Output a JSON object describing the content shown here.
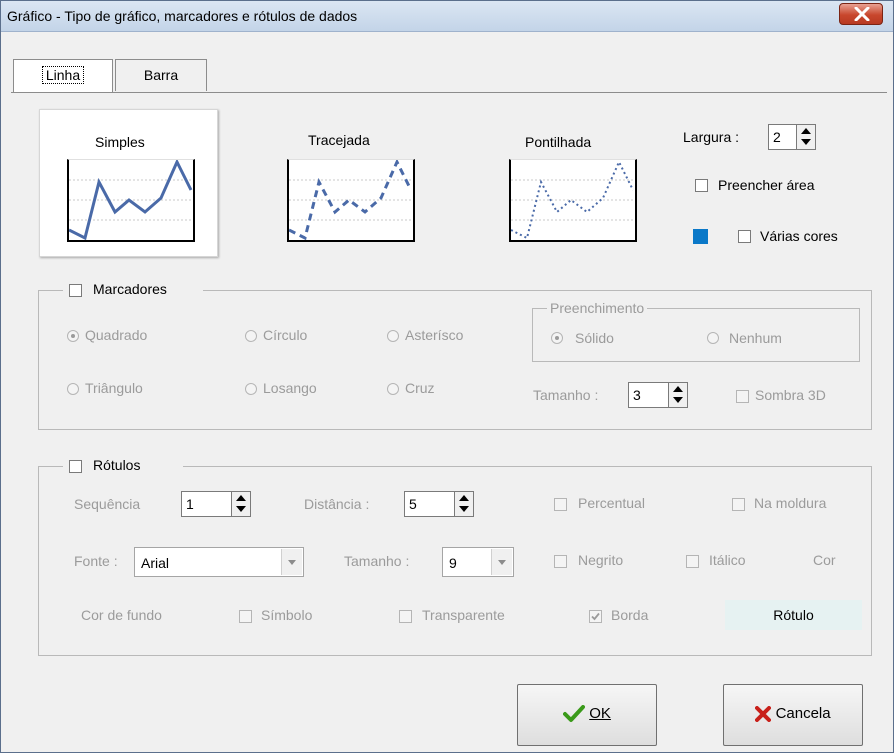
{
  "window": {
    "title": "Gráfico - Tipo de gráfico, marcadores e rótulos de dados",
    "close_icon": "x-icon"
  },
  "tabs": [
    {
      "label": "Linha",
      "active": true
    },
    {
      "label": "Barra",
      "active": false
    }
  ],
  "line_styles": [
    {
      "label": "Simples",
      "selected": true
    },
    {
      "label": "Tracejada",
      "selected": false
    },
    {
      "label": "Pontilhada",
      "selected": false
    }
  ],
  "line_options": {
    "width_label": "Largura :",
    "width_value": "2",
    "fill_area_label": "Preencher área",
    "multi_colors_label": "Várias cores",
    "swatch_color": "#0a78c8"
  },
  "markers": {
    "label": "Marcadores",
    "shapes": [
      "Quadrado",
      "Círculo",
      "Asterísco",
      "Triângulo",
      "Losango",
      "Cruz"
    ],
    "fill_group_label": "Preenchimento",
    "fill_options": [
      "Sólido",
      "Nenhum"
    ],
    "size_label": "Tamanho :",
    "size_value": "3",
    "shadow_label": "Sombra 3D"
  },
  "labels": {
    "label": "Rótulos",
    "sequence_label": "Sequência",
    "sequence_value": "1",
    "distance_label": "Distância :",
    "distance_value": "5",
    "percent_label": "Percentual",
    "in_frame_label": "Na moldura",
    "font_label": "Fonte :",
    "font_value": "Arial",
    "size_label": "Tamanho :",
    "size_value": "9",
    "bold_label": "Negrito",
    "italic_label": "Itálico",
    "color_label": "Cor",
    "bg_color_label": "Cor de fundo",
    "symbol_label": "Símbolo",
    "transparent_label": "Transparente",
    "border_label": "Borda",
    "preview_button_label": "Rótulo"
  },
  "buttons": {
    "ok_label": "OK",
    "cancel_label": "Cancela"
  },
  "colors": {
    "line_series": "#4a6aa8",
    "ok_check": "#3a9a1a",
    "cancel_x": "#c8201a"
  }
}
